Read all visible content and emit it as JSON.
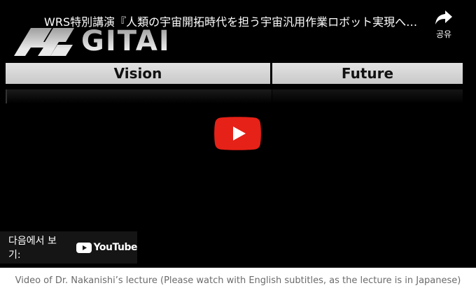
{
  "video": {
    "title": "WRS特別講演『人類の宇宙開拓時代を担う宇宙汎用作業ロボット実現への…",
    "share_label": "공유",
    "watch_on_label": "다음에서 보기:",
    "youtube_wordmark": "YouTube"
  },
  "frame": {
    "logo_text": "GITAI",
    "table_headers": [
      "Vision",
      "Future"
    ]
  },
  "caption": "Video of Dr. Nakanishi’s lecture (Please watch with English subtitles, as the lecture is in Japanese)",
  "icons": {
    "share": "share-arrow-icon",
    "play": "youtube-play-icon",
    "youtube": "youtube-logo-icon",
    "logo": "gitai-logo-icon"
  },
  "colors": {
    "play_red": "#e62117",
    "player_bg": "#000000",
    "caption_text": "#6b6b6b"
  }
}
